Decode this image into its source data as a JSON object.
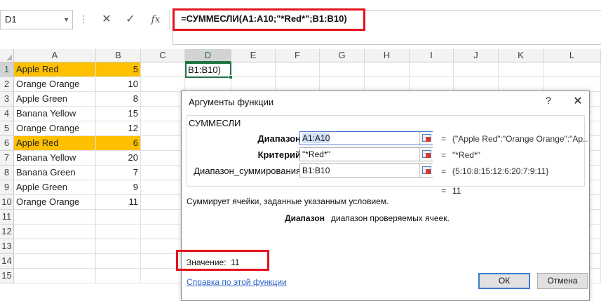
{
  "name_box": {
    "value": "D1"
  },
  "formula_bar": {
    "formula": "=СУММЕСЛИ(A1:A10;\"*Red*\";B1:B10)",
    "icons": [
      "cancel-icon",
      "enter-check-icon",
      "insert-function-fx-icon"
    ],
    "fx_glyph": "fx"
  },
  "grid": {
    "columns": [
      "A",
      "B",
      "C",
      "D",
      "E",
      "F",
      "G",
      "H",
      "I",
      "J",
      "K",
      "L"
    ],
    "rows": [
      "1",
      "2",
      "3",
      "4",
      "5",
      "6",
      "7",
      "8",
      "9",
      "10",
      "11",
      "12",
      "13",
      "14",
      "15"
    ],
    "data": [
      {
        "a": "Apple Red",
        "b": "5"
      },
      {
        "a": "Orange Orange",
        "b": "10"
      },
      {
        "a": "Apple Green",
        "b": "8"
      },
      {
        "a": "Banana Yellow",
        "b": "15"
      },
      {
        "a": "Orange Orange",
        "b": "12"
      },
      {
        "a": "Apple Red",
        "b": "6"
      },
      {
        "a": "Banana Yellow",
        "b": "20"
      },
      {
        "a": "Banana Green",
        "b": "7"
      },
      {
        "a": "Apple Green",
        "b": "9"
      },
      {
        "a": "Orange Orange",
        "b": "11"
      }
    ],
    "active_cell_text": "B1:B10)",
    "highlight_color": "#FFC000"
  },
  "dialog": {
    "title": "Аргументы функции",
    "help": "?",
    "close": "✕",
    "function_name": "СУММЕСЛИ",
    "args": [
      {
        "label": "Диапазон",
        "value": "A1:A10",
        "result": "{\"Apple Red\":\"Orange Orange\":\"Ap..."
      },
      {
        "label": "Критерий",
        "value": "\"*Red*\"",
        "result": "\"*Red*\""
      },
      {
        "label": "Диапазон_суммирования",
        "value": "B1:B10",
        "result": "{5:10:8:15:12:6:20:7:9:11}"
      }
    ],
    "eq_sign": "=",
    "total_result": "11",
    "description": "Суммирует ячейки, заданные указанным условием.",
    "arg_help_name": "Диапазон",
    "arg_help_text": "диапазон проверяемых ячеек.",
    "value_label": "Значение:",
    "value": "11",
    "help_link": "Справка по этой функции",
    "ok": "ОК",
    "cancel": "Отмена"
  },
  "colors": {
    "excel_green": "#217346",
    "callout_red": "#E3131B"
  }
}
